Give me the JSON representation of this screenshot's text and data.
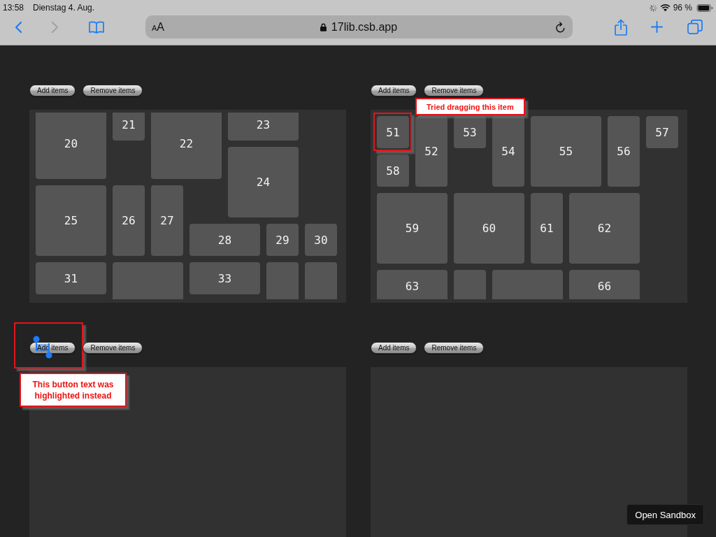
{
  "status_bar": {
    "time": "13:58",
    "date": "Dienstag 4. Aug.",
    "battery": "96 %"
  },
  "browser": {
    "nav_buttons": [
      {
        "kind": "back",
        "disabled": false
      },
      {
        "kind": "forward",
        "disabled": true
      }
    ],
    "text_size": "AA",
    "address": "17lib.csb.app"
  },
  "panels": [
    {
      "buttons": [
        {
          "label": "Add items",
          "outlined": false,
          "text_selected": false
        },
        {
          "label": "Remove items",
          "outlined": false,
          "text_selected": false
        }
      ],
      "scrolled": true,
      "items": [
        {
          "label": "20",
          "kind": "large",
          "outlined": false
        },
        {
          "label": "21",
          "kind": "small",
          "outlined": false
        },
        {
          "label": "22",
          "kind": "large",
          "outlined": false
        },
        {
          "label": "23",
          "kind": "wide",
          "outlined": false
        },
        {
          "label": "24",
          "kind": "large",
          "outlined": false
        },
        {
          "label": "25",
          "kind": "large",
          "outlined": false
        },
        {
          "label": "26",
          "kind": "tall",
          "outlined": false
        },
        {
          "label": "27",
          "kind": "tall",
          "outlined": false
        },
        {
          "label": "28",
          "kind": "wide",
          "outlined": false
        },
        {
          "label": "29",
          "kind": "small",
          "outlined": false
        },
        {
          "label": "30",
          "kind": "small",
          "outlined": false
        },
        {
          "label": "31",
          "kind": "wide",
          "outlined": false
        },
        {
          "kind": "large",
          "outlined": false
        },
        {
          "label": "33",
          "kind": "wide",
          "outlined": false
        },
        {
          "kind": "tall",
          "outlined": false
        },
        {
          "kind": "tall",
          "outlined": false
        }
      ]
    },
    {
      "buttons": [
        {
          "label": "Add items",
          "outlined": false,
          "text_selected": false
        },
        {
          "label": "Remove items",
          "outlined": false,
          "text_selected": false
        }
      ],
      "scrolled": false,
      "items": [
        {
          "label": "51",
          "kind": "small",
          "outlined": true
        },
        {
          "label": "52",
          "kind": "tall",
          "outlined": false
        },
        {
          "label": "53",
          "kind": "small",
          "outlined": false
        },
        {
          "label": "54",
          "kind": "tall",
          "outlined": false
        },
        {
          "label": "55",
          "kind": "large",
          "outlined": false
        },
        {
          "label": "56",
          "kind": "tall",
          "outlined": false
        },
        {
          "label": "57",
          "kind": "small",
          "outlined": false
        },
        {
          "label": "58",
          "kind": "small",
          "outlined": false
        },
        {
          "label": "59",
          "kind": "large",
          "outlined": false
        },
        {
          "label": "60",
          "kind": "large",
          "outlined": false
        },
        {
          "label": "61",
          "kind": "tall",
          "outlined": false
        },
        {
          "label": "62",
          "kind": "large",
          "outlined": false
        },
        {
          "label": "63",
          "kind": "wide",
          "outlined": false
        },
        {
          "kind": "tall",
          "outlined": false
        },
        {
          "kind": "large",
          "outlined": false
        },
        {
          "label": "66",
          "kind": "wide",
          "outlined": false
        }
      ],
      "callout": {
        "kind": "item",
        "text": "Tried dragging this item"
      }
    },
    {
      "buttons": [
        {
          "label": "Add items",
          "outlined": true,
          "text_selected": true
        },
        {
          "label": "Remove items",
          "outlined": false,
          "text_selected": false
        }
      ],
      "callout": {
        "kind": "button",
        "text": "This button text was highlighted instead"
      }
    },
    {
      "buttons": [
        {
          "label": "Add items",
          "outlined": false,
          "text_selected": false
        },
        {
          "label": "Remove items",
          "outlined": false,
          "text_selected": false
        }
      ]
    }
  ],
  "open_sandbox_button": "Open Sandbox"
}
